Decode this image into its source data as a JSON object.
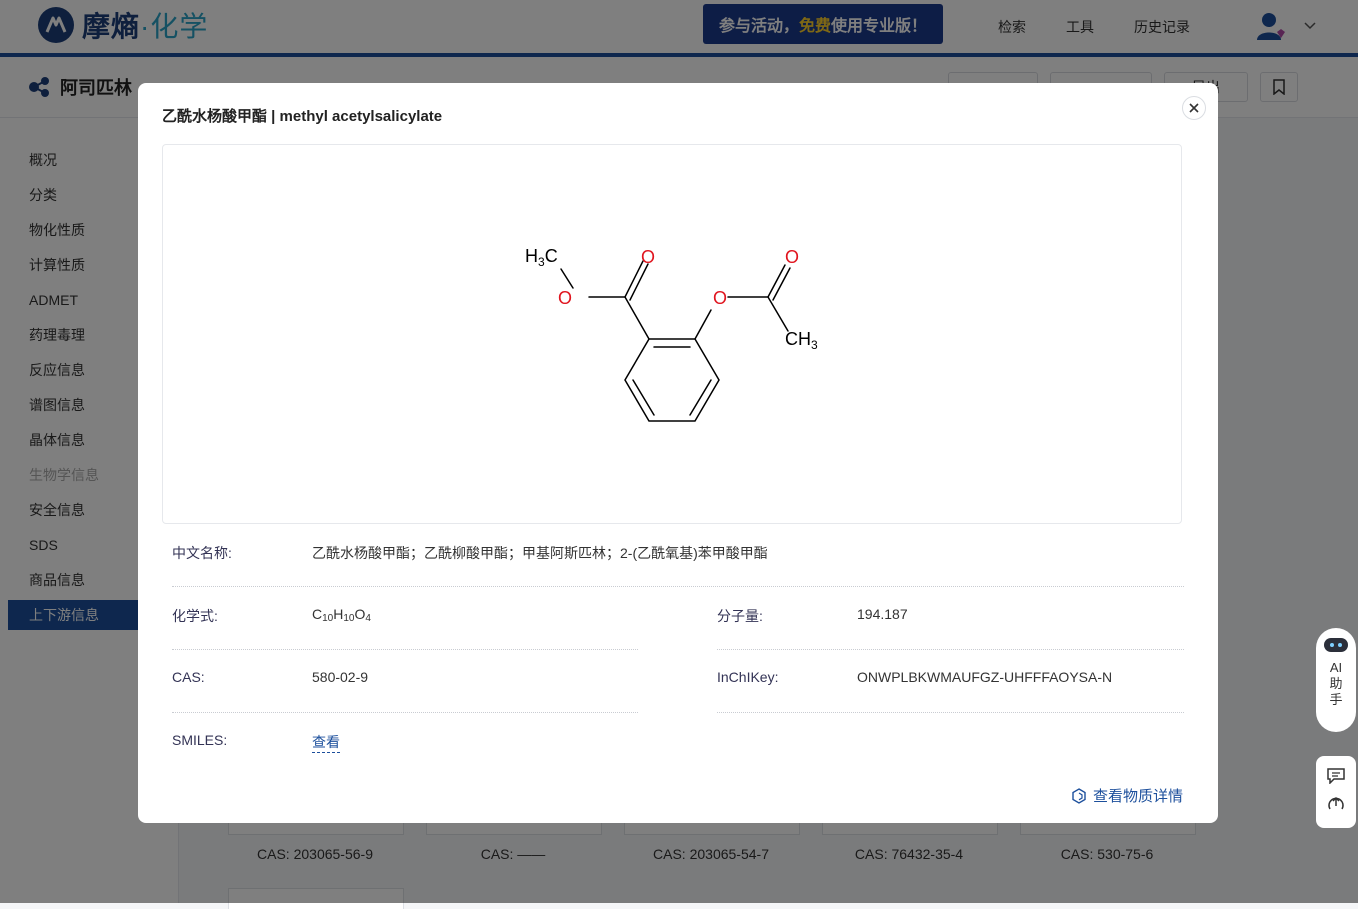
{
  "header": {
    "logo_text_main": "摩熵",
    "logo_dot": "·",
    "logo_text_accent": "化学",
    "promo": {
      "part1": "参与活动，",
      "highlight": "免费",
      "part2": "使用专业版！"
    },
    "nav": [
      "检索",
      "工具",
      "历史记录"
    ]
  },
  "subheader": {
    "title": "阿司匹林",
    "buttons": [
      "导出"
    ]
  },
  "sidebar": {
    "items": [
      "概况",
      "分类",
      "物化性质",
      "计算性质",
      "ADMET",
      "药理毒理",
      "反应信息",
      "谱图信息",
      "晶体信息",
      "生物学信息",
      "安全信息",
      "SDS",
      "商品信息",
      "上下游信息"
    ],
    "disabled_index": 9,
    "active_index": 13
  },
  "cards": [
    {
      "cas": "CAS: 203065-56-9"
    },
    {
      "cas": "CAS: ——"
    },
    {
      "cas": "CAS: 203065-54-7"
    },
    {
      "cas": "CAS: 76432-35-4"
    },
    {
      "cas": "CAS: 530-75-6"
    }
  ],
  "assistant": {
    "label": "AI助手"
  },
  "modal": {
    "title": "乙酰水杨酸甲酯 | methyl acetylsalicylate",
    "structure_labels": {
      "h3c": "H",
      "h3c_sub": "3",
      "h3c_c": "C",
      "ch3": "CH",
      "ch3_sub": "3",
      "o": "O"
    },
    "fields": {
      "chinese_name_label": "中文名称:",
      "chinese_name_value": "乙酰水杨酸甲酯；乙酰柳酸甲酯；甲基阿斯匹林；2-(乙酰氧基)苯甲酸甲酯",
      "formula_label": "化学式:",
      "formula": {
        "c": "C",
        "c_n": "10",
        "h": "H",
        "h_n": "10",
        "o": "O",
        "o_n": "4"
      },
      "mw_label": "分子量:",
      "mw_value": "194.187",
      "cas_label": "CAS:",
      "cas_value": "580-02-9",
      "inchikey_label": "InChIKey:",
      "inchikey_value": "ONWPLBKWMAUFGZ-UHFFFAOYSA-N",
      "smiles_label": "SMILES:",
      "smiles_link": "查看"
    },
    "detail_link": "查看物质详情"
  },
  "colors": {
    "brand": "#1c4f9c",
    "accent": "#2aa3c7",
    "oxygen": "#e0141e"
  }
}
